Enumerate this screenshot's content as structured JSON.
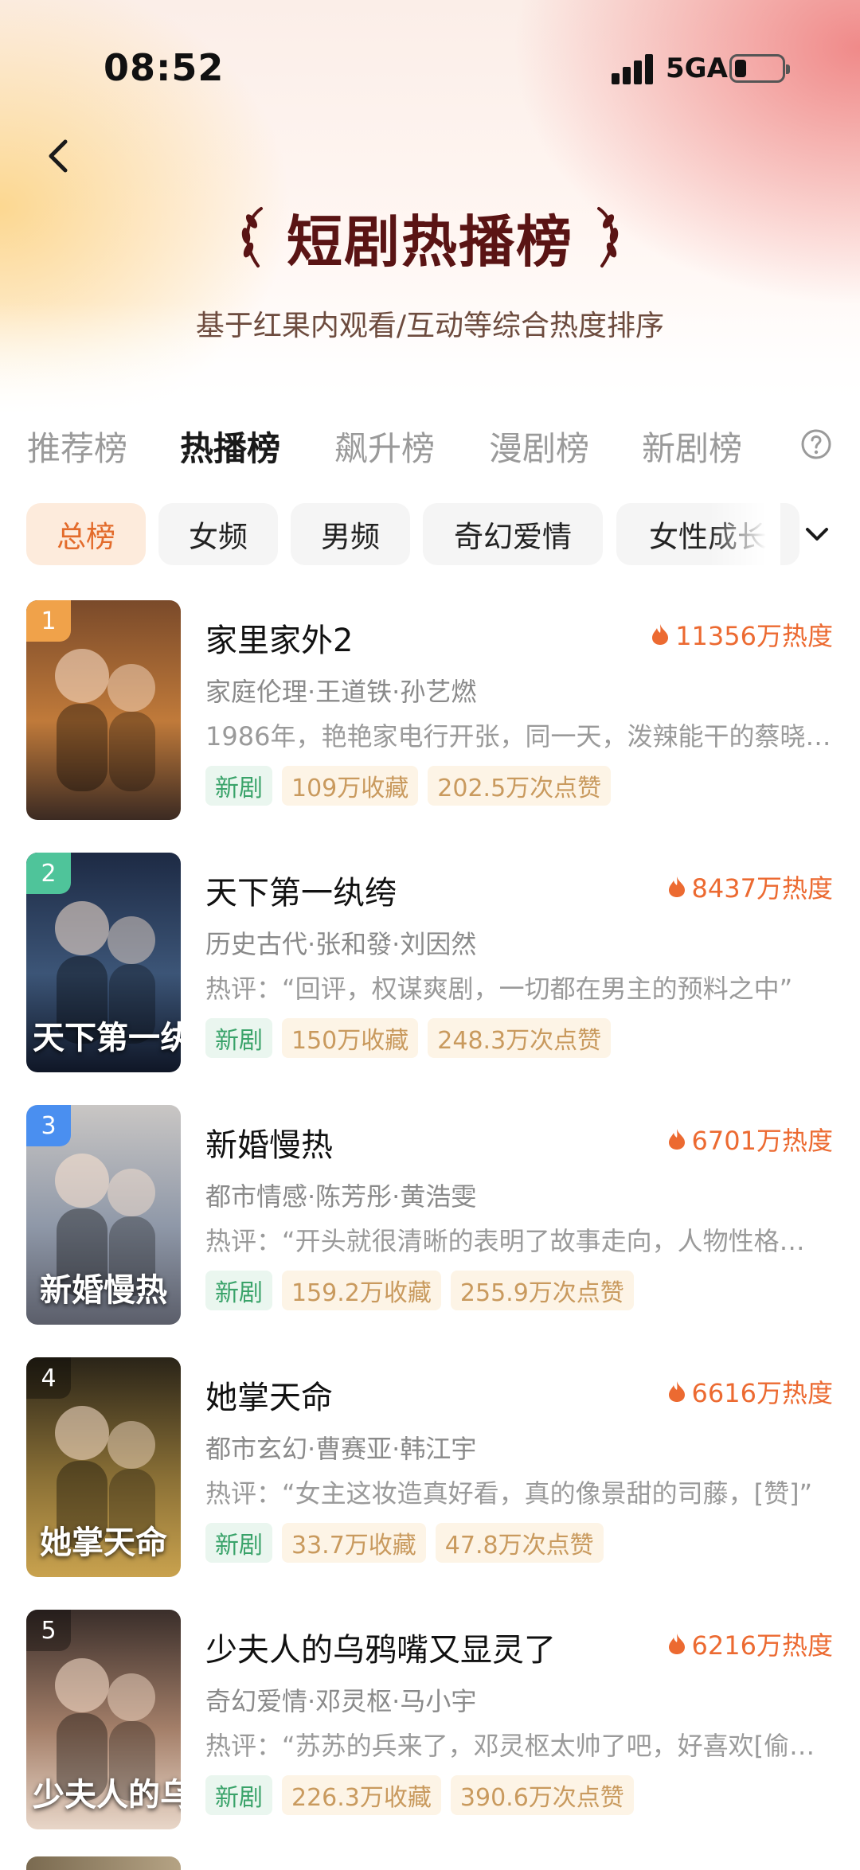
{
  "status_bar": {
    "time": "08:52",
    "network": "5GA"
  },
  "header": {
    "title": "短剧热播榜",
    "subtitle": "基于红果内观看/互动等综合热度排序"
  },
  "tabs": [
    {
      "label": "推荐榜",
      "active": false
    },
    {
      "label": "热播榜",
      "active": true
    },
    {
      "label": "飙升榜",
      "active": false
    },
    {
      "label": "漫剧榜",
      "active": false
    },
    {
      "label": "新剧榜",
      "active": false
    }
  ],
  "chips": [
    {
      "label": "总榜",
      "active": true
    },
    {
      "label": "女频",
      "active": false
    },
    {
      "label": "男频",
      "active": false
    },
    {
      "label": "奇幻爱情",
      "active": false
    },
    {
      "label": "女性成长",
      "active": false
    }
  ],
  "colors": {
    "accent": "#ec6a31",
    "title": "#5a1414",
    "new_tag": "#3aa36a",
    "stat_tag": "#c99a5e"
  },
  "items": [
    {
      "rank": "1",
      "rank_color": "#f0a24a",
      "cover_text": "",
      "cover_colors": [
        "#7a4a2a",
        "#c07a3a",
        "#3b2a22"
      ],
      "title": "家里家外2",
      "heat": "11356万热度",
      "meta": "家庭伦理·王道铁·孙艺燃",
      "desc": "1986年，艳艳家电行开张，同一天，泼辣能干的蔡晓…",
      "tag_new": "新剧",
      "collect": "109万收藏",
      "likes": "202.5万次点赞"
    },
    {
      "rank": "2",
      "rank_color": "#4fc49a",
      "cover_text": "天下第一纨绔",
      "cover_colors": [
        "#1d2a44",
        "#3c5577",
        "#0f1626"
      ],
      "title": "天下第一纨绔",
      "heat": "8437万热度",
      "meta": "历史古代·张和發·刘因然",
      "desc": "热评：“回评，权谋爽剧，一切都在男主的预料之中”",
      "tag_new": "新剧",
      "collect": "150万收藏",
      "likes": "248.3万次点赞"
    },
    {
      "rank": "3",
      "rank_color": "#4a8ff0",
      "cover_text": "新婚慢热",
      "cover_colors": [
        "#c9c6c4",
        "#8f98a8",
        "#5b5e6a"
      ],
      "title": "新婚慢热",
      "heat": "6701万热度",
      "meta": "都市情感·陈芳彤·黄浩雯",
      "desc": "热评：“开头就很清晰的表明了故事走向，人物性格…",
      "tag_new": "新剧",
      "collect": "159.2万收藏",
      "likes": "255.9万次点赞"
    },
    {
      "rank": "4",
      "rank_color": "rgba(0,0,0,0.35)",
      "cover_text": "她掌天命",
      "cover_colors": [
        "#2a2418",
        "#8a7036",
        "#c9a24e"
      ],
      "title": "她掌天命",
      "heat": "6616万热度",
      "meta": "都市玄幻·曹赛亚·韩江宇",
      "desc": "热评：“女主这妆造真好看，真的像景甜的司藤，[赞]”",
      "tag_new": "新剧",
      "collect": "33.7万收藏",
      "likes": "47.8万次点赞"
    },
    {
      "rank": "5",
      "rank_color": "rgba(0,0,0,0.35)",
      "cover_text": "少夫人的乌鸦嘴又显灵了",
      "cover_colors": [
        "#3a2e2a",
        "#a5806a",
        "#e8d6c8"
      ],
      "title": "少夫人的乌鸦嘴又显灵了",
      "heat": "6216万热度",
      "meta": "奇幻爱情·邓灵枢·马小宇",
      "desc": "热评：“苏苏的兵来了，邓灵枢太帅了吧，好喜欢[偷…",
      "tag_new": "新剧",
      "collect": "226.3万收藏",
      "likes": "390.6万次点赞"
    }
  ]
}
